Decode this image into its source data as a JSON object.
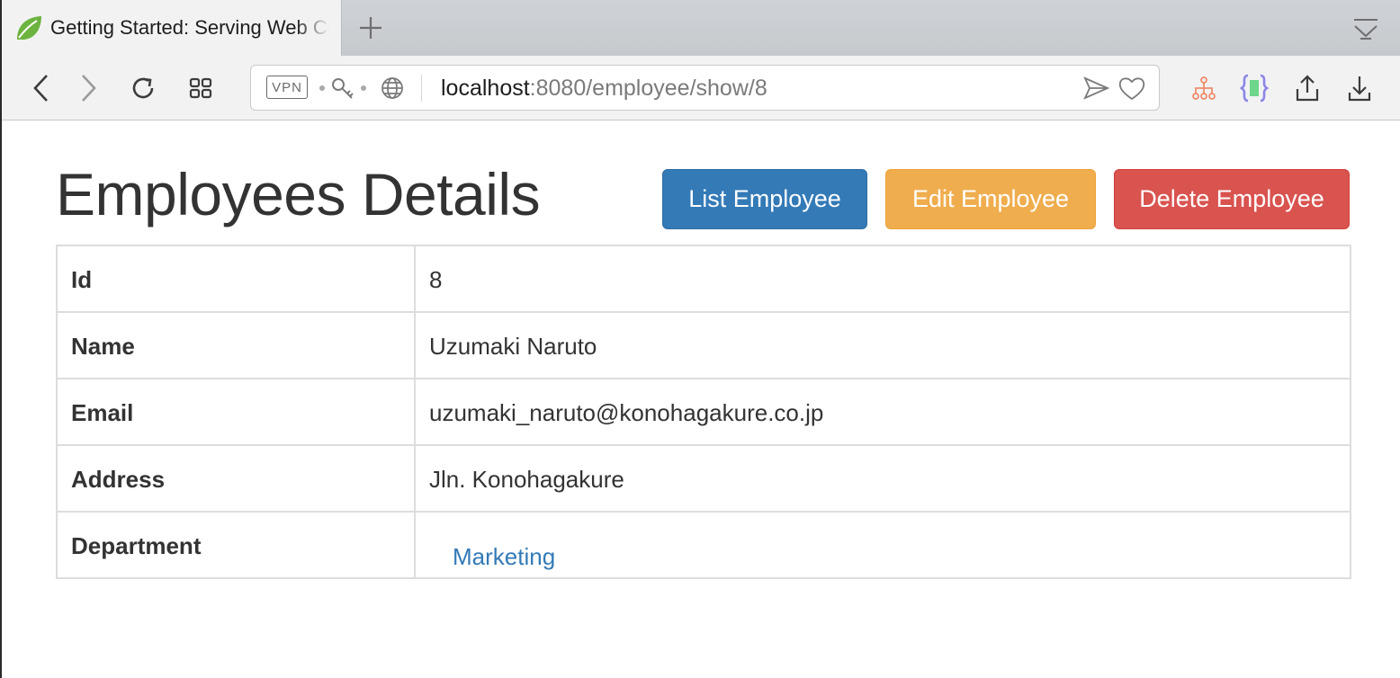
{
  "browser": {
    "tab": {
      "title": "Getting Started: Serving Web Content"
    },
    "address_bar": {
      "vpn_label": "VPN",
      "url_host": "localhost",
      "url_rest": ":8080/employee/show/8"
    },
    "icons": {
      "favicon": "spring-leaf-icon",
      "new_tab": "plus-icon",
      "tab_menu": "tab-menu-icon",
      "back": "chevron-left-icon",
      "forward": "chevron-right-icon",
      "reload": "reload-icon",
      "speed_dial": "grid-icon",
      "key": "key-icon",
      "globe": "globe-icon",
      "send": "send-icon",
      "bookmark": "heart-icon",
      "ext_sitemap": "sitemap-icon",
      "ext_json": "json-braces-icon",
      "share": "share-icon",
      "download": "download-icon"
    }
  },
  "page": {
    "title": "Employees Details",
    "buttons": {
      "list": "List Employee",
      "edit": "Edit Employee",
      "delete": "Delete Employee"
    },
    "colors": {
      "primary": "#337ab7",
      "warning": "#f0ad4e",
      "danger": "#d9534f"
    },
    "details": [
      {
        "label": "Id",
        "value": "8"
      },
      {
        "label": "Name",
        "value": "Uzumaki Naruto"
      },
      {
        "label": "Email",
        "value": "uzumaki_naruto@konohagakure.co.jp"
      },
      {
        "label": "Address",
        "value": "Jln. Konohagakure"
      },
      {
        "label": "Department",
        "value": "Marketing"
      }
    ]
  }
}
